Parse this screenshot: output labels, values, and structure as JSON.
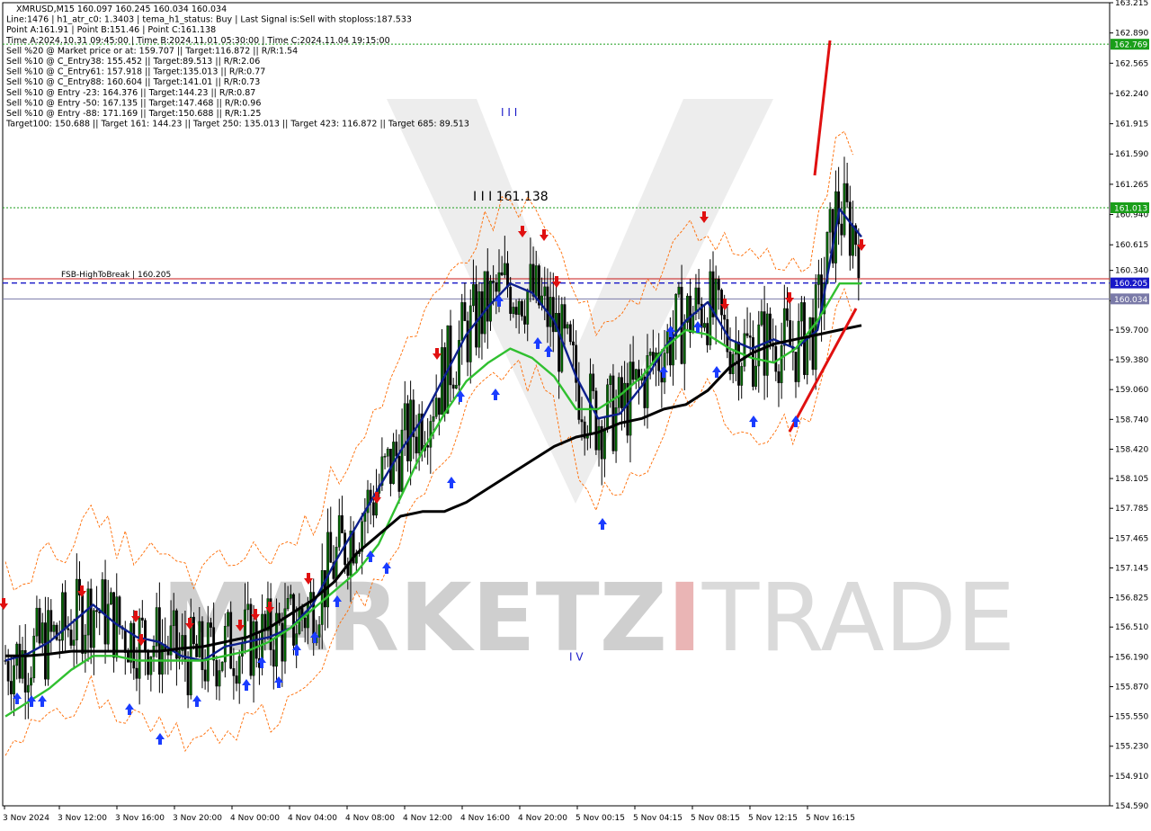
{
  "header": {
    "lines": [
      "XMRUSD,M15  160.097 160.245 160.034 160.034",
      "Line:1476  |  h1_atr_c0: 1.3403  |  tema_h1_status: Buy  |  Last Signal is:Sell with stoploss:187.533",
      "Point A:161.91  |  Point B:151.46  |  Point C:161.138",
      "Time A:2024.10.31 09:45:00  |  Time B:2024.11.01 05:30:00  |  Time C:2024.11.04 19:15:00",
      "Sell %20 @ Market price or at: 159.707  ||  Target:116.872  ||  R/R:1.54",
      "Sell %10 @ C_Entry38: 155.452  ||  Target:89.513  ||  R/R:2.06",
      "Sell %10 @ C_Entry61: 157.918  ||  Target:135.013  ||  R/R:0.77",
      "Sell %10 @ C_Entry88: 160.604  ||  Target:141.01  ||  R/R:0.73",
      "Sell %10 @ Entry -23: 164.376  ||  Target:144.23  ||  R/R:0.87",
      "Sell %10 @ Entry -50: 167.135  ||  Target:147.468  ||  R/R:0.96",
      "Sell %10 @ Entry -88: 171.169  ||  Target:150.688  ||  R/R:1.25",
      "Target100: 150.688  ||  Target 161: 144.23  ||  Target 250: 135.013  ||  Target 423: 116.872  ||  Target 685: 89.513"
    ]
  },
  "watermark": {
    "text_dark": "MARKETZ",
    "text_red": "I",
    "text_light": "TRADE"
  },
  "chart_data": {
    "type": "candlestick",
    "symbol": "XMRUSD",
    "timeframe": "M15",
    "ylim": [
      154.59,
      163.215
    ],
    "y_ticks": [
      "163.215",
      "162.890",
      "162.565",
      "162.240",
      "161.915",
      "161.590",
      "161.265",
      "160.940",
      "160.615",
      "160.340",
      "160.015",
      "159.700",
      "159.380",
      "159.060",
      "158.740",
      "158.420",
      "158.105",
      "157.785",
      "157.465",
      "157.145",
      "156.825",
      "156.510",
      "156.190",
      "155.870",
      "155.550",
      "155.230",
      "154.910",
      "154.590"
    ],
    "x_ticks": [
      "3 Nov 2024",
      "3 Nov 12:00",
      "3 Nov 16:00",
      "3 Nov 20:00",
      "4 Nov 00:00",
      "4 Nov 04:00",
      "4 Nov 08:00",
      "4 Nov 12:00",
      "4 Nov 16:00",
      "4 Nov 20:00",
      "5 Nov 00:15",
      "5 Nov 04:15",
      "5 Nov 08:15",
      "5 Nov 12:15",
      "5 Nov 16:15"
    ],
    "levels": [
      {
        "label": "162.769",
        "value": 162.769,
        "color": "#1a9e1a",
        "style": "dotted"
      },
      {
        "label": "161.013",
        "value": 161.013,
        "color": "#1a9e1a",
        "style": "dotted"
      },
      {
        "label": "160.205",
        "value": 160.205,
        "color": "#1818c8",
        "style": "dashed"
      },
      {
        "label": "160.034",
        "value": 160.034,
        "color": "#7a7aa8",
        "style": "solid"
      }
    ],
    "fsb_label": "FSB-HighToBreak  |  160.205",
    "fsb_value": 160.25,
    "wave_labels": [
      {
        "text": "I I I 161.138",
        "value": 161.138
      },
      {
        "text": "I I I",
        "value": 162.0
      },
      {
        "text": "I V",
        "value": 156.15
      }
    ],
    "series": [
      {
        "name": "MA blue",
        "color": "#0c1f8c",
        "values": [
          156.15,
          156.22,
          156.35,
          156.55,
          156.75,
          156.55,
          156.4,
          156.35,
          156.2,
          156.15,
          156.3,
          156.35,
          156.4,
          156.5,
          156.75,
          157.2,
          157.6,
          158.0,
          158.4,
          158.75,
          159.2,
          159.65,
          159.95,
          160.2,
          160.1,
          159.8,
          159.2,
          158.75,
          158.8,
          159.1,
          159.5,
          159.8,
          160.0,
          159.6,
          159.5,
          159.6,
          159.5,
          159.7,
          161.0,
          160.7
        ],
        "x_ticks_index": "candles 0-39"
      },
      {
        "name": "MA green",
        "color": "#30c030",
        "values": [
          155.55,
          155.7,
          155.85,
          156.05,
          156.2,
          156.2,
          156.15,
          156.15,
          156.15,
          156.15,
          156.2,
          156.25,
          156.35,
          156.5,
          156.7,
          156.9,
          157.1,
          157.4,
          157.9,
          158.4,
          158.8,
          159.15,
          159.35,
          159.5,
          159.4,
          159.2,
          158.85,
          158.85,
          159.0,
          159.2,
          159.5,
          159.7,
          159.65,
          159.5,
          159.4,
          159.35,
          159.5,
          159.8,
          160.2,
          160.2
        ]
      },
      {
        "name": "MA black",
        "color": "#000000",
        "values": [
          156.2,
          156.2,
          156.22,
          156.25,
          156.25,
          156.25,
          156.25,
          156.25,
          156.28,
          156.3,
          156.35,
          156.4,
          156.5,
          156.65,
          156.8,
          157.0,
          157.3,
          157.5,
          157.7,
          157.75,
          157.75,
          157.85,
          158.0,
          158.15,
          158.3,
          158.45,
          158.55,
          158.6,
          158.7,
          158.75,
          158.85,
          158.9,
          159.05,
          159.3,
          159.45,
          159.55,
          159.6,
          159.65,
          159.7,
          159.75
        ]
      }
    ]
  }
}
